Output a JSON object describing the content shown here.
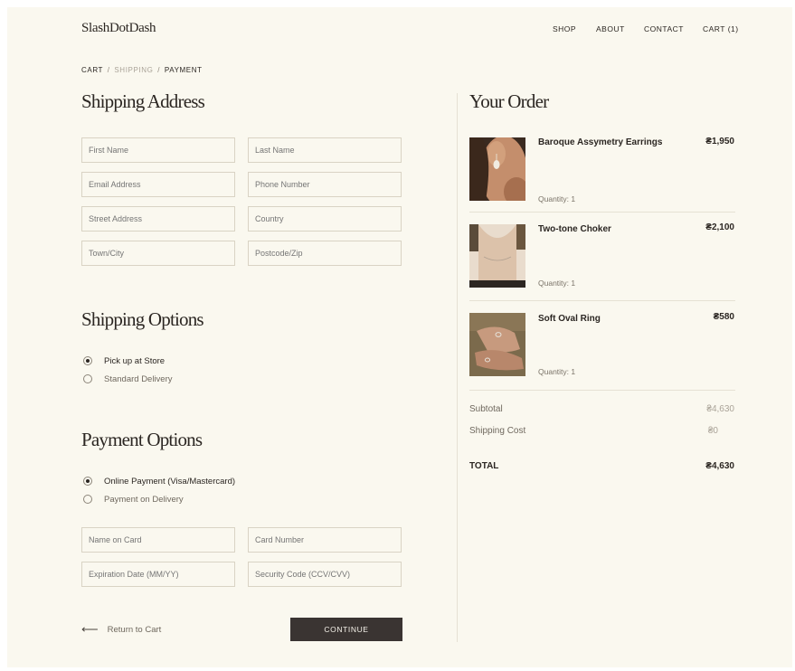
{
  "brand": {
    "logo": "SlashDotDash"
  },
  "nav": {
    "shop": "SHOP",
    "about": "ABOUT",
    "contact": "CONTACT",
    "cart": "CART (1)"
  },
  "breadcrumb": {
    "cart": "CART",
    "sep1": "/",
    "shipping": "SHIPPING",
    "sep2": "/",
    "payment": "PAYMENT"
  },
  "shipping_address": {
    "title": "Shipping Address",
    "fields": {
      "first_name": "First Name",
      "last_name": "Last Name",
      "email": "Email Address",
      "phone": "Phone Number",
      "street": "Street Address",
      "country": "Country",
      "town": "Town/City",
      "postcode": "Postcode/Zip"
    }
  },
  "shipping_options": {
    "title": "Shipping Options",
    "options": [
      {
        "label": "Pick up at Store",
        "selected": true
      },
      {
        "label": "Standard Delivery",
        "selected": false
      }
    ]
  },
  "payment_options": {
    "title": "Payment Options",
    "options": [
      {
        "label": "Online Payment (Visa/Mastercard)",
        "selected": true
      },
      {
        "label": "Payment on Delivery",
        "selected": false
      }
    ],
    "fields": {
      "name_on_card": "Name on Card",
      "card_number": "Card Number",
      "expiration": "Expiration Date (MM/YY)",
      "security": "Security Code (CCV/CVV)"
    }
  },
  "actions": {
    "return": "Return to Cart",
    "continue": "CONTINUE"
  },
  "order": {
    "title": "Your Order",
    "items": [
      {
        "name": "Baroque Assymetry Earrings",
        "price": "₴1,950",
        "quantity": "Quantity: 1"
      },
      {
        "name": "Two-tone Choker",
        "price": "₴2,100",
        "quantity": "Quantity: 1"
      },
      {
        "name": "Soft Oval Ring",
        "price": "₴580",
        "quantity": "Quantity: 1"
      }
    ],
    "subtotal_label": "Subtotal",
    "subtotal": "₴4,630",
    "shipping_label": "Shipping Cost",
    "shipping": "₴0",
    "total_label": "TOTAL",
    "total": "₴4,630"
  },
  "colors": {
    "background": "#faf8ef",
    "text": "#2b2622",
    "button": "#3a3432",
    "border": "#d9d3c4"
  }
}
